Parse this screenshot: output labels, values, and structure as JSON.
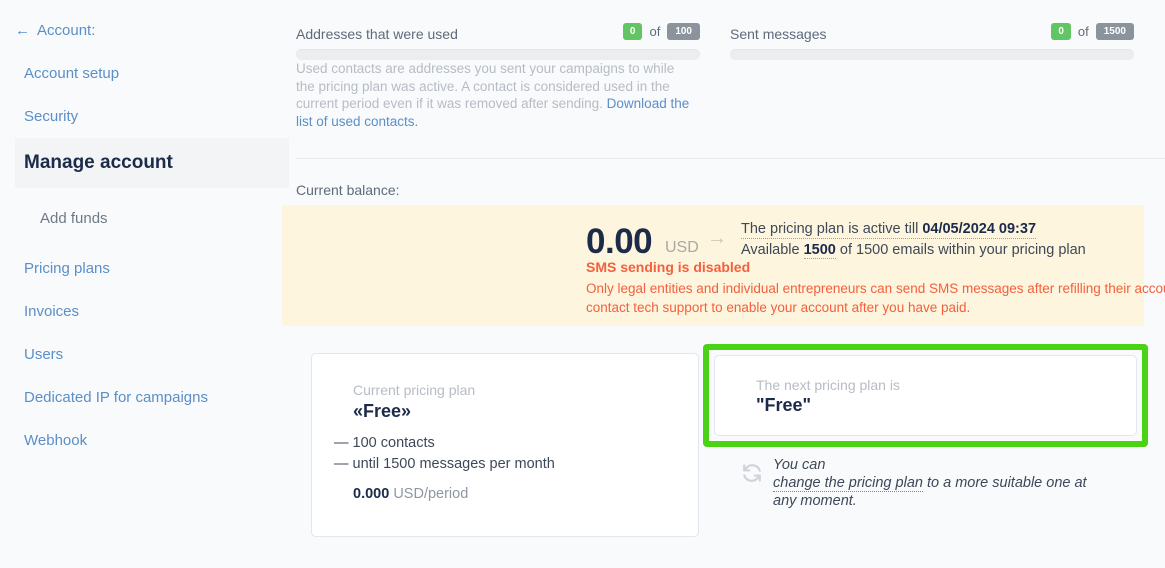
{
  "sidebar": {
    "back": {
      "label": "Account:",
      "icon": "arrow-left-icon"
    },
    "items": [
      {
        "key": "account-setup",
        "label": "Account setup",
        "active": false,
        "indent": false
      },
      {
        "key": "security",
        "label": "Security",
        "active": false,
        "indent": false
      },
      {
        "key": "manage-account",
        "label": "Manage account",
        "active": true,
        "indent": false
      },
      {
        "key": "add-funds",
        "label": "Add funds",
        "active": false,
        "indent": true
      },
      {
        "key": "pricing-plans",
        "label": "Pricing plans",
        "active": false,
        "indent": false
      },
      {
        "key": "invoices",
        "label": "Invoices",
        "active": false,
        "indent": false
      },
      {
        "key": "users",
        "label": "Users",
        "active": false,
        "indent": false
      },
      {
        "key": "dedicated-ip",
        "label": "Dedicated IP for campaigns",
        "active": false,
        "indent": false
      },
      {
        "key": "webhook",
        "label": "Webhook",
        "active": false,
        "indent": false
      }
    ]
  },
  "meters": {
    "addresses": {
      "title": "Addresses that were used",
      "used": "0",
      "of": "of",
      "limit": "100",
      "percent": 0,
      "description_prefix": "Used contacts are addresses you sent your campaigns to while the pricing plan was active. A contact is considered used in the current period even if it was removed after sending. ",
      "link_text": "Download the list of used contacts."
    },
    "messages": {
      "title": "Sent messages",
      "used": "0",
      "of": "of",
      "limit": "1500",
      "percent": 0
    }
  },
  "balance": {
    "label": "Current balance:",
    "amount": "0.00",
    "currency": "USD",
    "arrow_icon": "arrow-right-icon",
    "plan_active_prefix": "The pricing plan is active till ",
    "plan_active_date": "04/05/2024 09:37",
    "available_prefix": "Available ",
    "available_value": "1500",
    "available_suffix": " of 1500 emails within your pricing plan",
    "sms_disabled": "SMS sending is disabled",
    "sms_note": "Only legal entities and individual entrepreneurs can send SMS messages after refilling their account via an account agreement. Please contact tech support to enable your account after you have paid."
  },
  "current_plan": {
    "caption": "Current pricing plan",
    "name": "«Free»",
    "feature1": "— 100 contacts",
    "feature2": "— until 1500 messages per month",
    "price_value": "0.000",
    "price_unit": " USD/period"
  },
  "next_plan": {
    "caption": "The next pricing plan is",
    "name": "\"Free\"",
    "highlight_color": "#4ad314"
  },
  "change_note": {
    "icon": "sync-refresh-icon",
    "line1": "You can",
    "link": "change the pricing plan",
    "line2_suffix": " to a more suitable one at",
    "line3": "any moment."
  },
  "colors": {
    "page_bg": "#f8fafc",
    "link": "#5b8fc7",
    "green_badge": "#62c462",
    "gray_badge": "#8b939c",
    "banner_bg": "#fdf5dd",
    "warning_text": "#f4603e",
    "highlight_green": "#4ad314"
  }
}
